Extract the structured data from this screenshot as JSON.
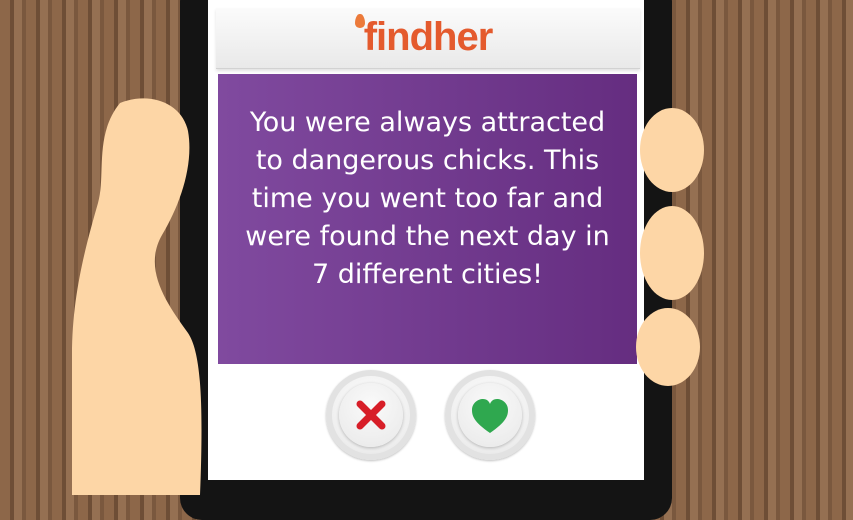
{
  "app": {
    "logo_text": "findher"
  },
  "card": {
    "message": "You were always attracted to dangerous chicks. This time you went too far and were found the next day in 7 different cities!"
  },
  "buttons": {
    "dislike_icon": "x-icon",
    "like_icon": "heart-icon"
  },
  "colors": {
    "brand": "#e45a2d",
    "card": "#7a3e98",
    "dislike": "#d71e28",
    "like": "#2fa84f",
    "skin": "#fdd6a6"
  }
}
